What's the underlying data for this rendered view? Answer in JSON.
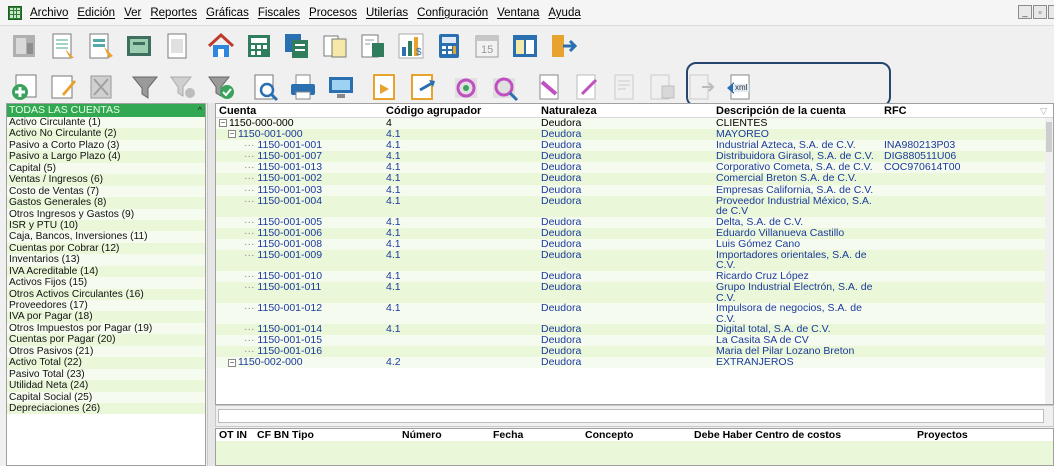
{
  "menu": [
    {
      "label": "Archivo"
    },
    {
      "label": "Edición"
    },
    {
      "label": "Ver"
    },
    {
      "label": "Reportes"
    },
    {
      "label": "Gráficas"
    },
    {
      "label": "Fiscales"
    },
    {
      "label": "Procesos"
    },
    {
      "label": "Utilerías"
    },
    {
      "label": "Configuración"
    },
    {
      "label": "Ventana"
    },
    {
      "label": "Ayuda"
    }
  ],
  "window_controls": {
    "minimize": "_",
    "restore": "▫"
  },
  "toolbar1_icons": [
    "company-icon",
    "catalog-icon",
    "accounts-icon",
    "policies-icon",
    "balance-icon",
    "home-icon",
    "calculator-doc-icon",
    "copy-icon",
    "documents-icon",
    "report-icon",
    "chart-icon",
    "calculator-icon",
    "calendar-icon",
    "window-icon",
    "exit-icon"
  ],
  "toolbar2_icons": [
    "add-account-icon",
    "edit-account-icon",
    "delete-account-icon",
    "filter-icon",
    "filter-clear-icon",
    "filter-apply-icon",
    "search-icon",
    "print-icon",
    "screen-preview-icon",
    "folder-icon",
    "export-icon",
    "ring-icon",
    "ring-search-icon",
    "document-link-icon",
    "document-edit-icon",
    "document-stamp-icon",
    "document-send-icon",
    "document-export-icon",
    "xml-icon"
  ],
  "xml_label": "xml",
  "sidebar": {
    "header": "TODAS LAS CUENTAS",
    "items": [
      "Activo Circulante (1)",
      "Activo No Circulante (2)",
      "Pasivo a Corto Plazo (3)",
      "Pasivo a Largo Plazo (4)",
      "Capital (5)",
      "Ventas / Ingresos (6)",
      "Costo de Ventas (7)",
      "Gastos Generales (8)",
      "Otros Ingresos y Gastos (9)",
      "ISR y PTU (10)",
      "Caja, Bancos, Inversiones (11)",
      "Cuentas por Cobrar (12)",
      "Inventarios (13)",
      "IVA Acreditable (14)",
      "Activos Fijos (15)",
      "Otros Activos Circulantes (16)",
      "Proveedores (17)",
      "IVA por Pagar (18)",
      "Otros Impuestos por Pagar (19)",
      "Cuentas por Pagar (20)",
      "Otros Pasivos (21)",
      "Activo Total (22)",
      "Pasivo Total (23)",
      "Utilidad Neta (24)",
      "Capital Social (25)",
      "Depreciaciones (26)"
    ]
  },
  "grid": {
    "columns": [
      "Cuenta",
      "Código agrupador",
      "Naturaleza",
      "Descripción de la cuenta",
      "RFC"
    ],
    "rows": [
      {
        "cuenta": "1150-000-000",
        "codigo": "4",
        "naturaleza": "Deudora",
        "descripcion": "CLIENTES",
        "rfc": "",
        "level": 0
      },
      {
        "cuenta": "1150-001-000",
        "codigo": "4.1",
        "naturaleza": "Deudora",
        "descripcion": "MAYOREO",
        "rfc": "",
        "level": 1
      },
      {
        "cuenta": "1150-001-001",
        "codigo": "4.1",
        "naturaleza": "Deudora",
        "descripcion": "Industrial Azteca, S.A. de C.V.",
        "rfc": "INA980213P03",
        "level": 2
      },
      {
        "cuenta": "1150-001-007",
        "codigo": "4.1",
        "naturaleza": "Deudora",
        "descripcion": "Distribuidora Girasol, S.A. de C.V.",
        "rfc": "DIG880511U06",
        "level": 2
      },
      {
        "cuenta": "1150-001-013",
        "codigo": "4.1",
        "naturaleza": "Deudora",
        "descripcion": "Corporativo Cometa, S.A. de C.V.",
        "rfc": "COC970614T00",
        "level": 2
      },
      {
        "cuenta": "1150-001-002",
        "codigo": "4.1",
        "naturaleza": "Deudora",
        "descripcion": "Comercial Breton S.A. de C.V.",
        "rfc": "",
        "level": 2
      },
      {
        "cuenta": "1150-001-003",
        "codigo": "4.1",
        "naturaleza": "Deudora",
        "descripcion": "Empresas California, S.A. de C.V.",
        "rfc": "",
        "level": 2
      },
      {
        "cuenta": "1150-001-004",
        "codigo": "4.1",
        "naturaleza": "Deudora",
        "descripcion": "Proveedor Industrial México, S.A. de C.V",
        "rfc": "",
        "level": 2,
        "tall": true
      },
      {
        "cuenta": "1150-001-005",
        "codigo": "4.1",
        "naturaleza": "Deudora",
        "descripcion": "Delta, S.A. de C.V.",
        "rfc": "",
        "level": 2
      },
      {
        "cuenta": "1150-001-006",
        "codigo": "4.1",
        "naturaleza": "Deudora",
        "descripcion": "Eduardo Villanueva Castillo",
        "rfc": "",
        "level": 2
      },
      {
        "cuenta": "1150-001-008",
        "codigo": "4.1",
        "naturaleza": "Deudora",
        "descripcion": "Luis Gómez Cano",
        "rfc": "",
        "level": 2
      },
      {
        "cuenta": "1150-001-009",
        "codigo": "4.1",
        "naturaleza": "Deudora",
        "descripcion": "Importadores orientales, S.A. de C.V.",
        "rfc": "",
        "level": 2,
        "tall": true
      },
      {
        "cuenta": "1150-001-010",
        "codigo": "4.1",
        "naturaleza": "Deudora",
        "descripcion": "Ricardo Cruz López",
        "rfc": "",
        "level": 2
      },
      {
        "cuenta": "1150-001-011",
        "codigo": "4.1",
        "naturaleza": "Deudora",
        "descripcion": "Grupo Industrial Electrón, S.A. de C.V.",
        "rfc": "",
        "level": 2,
        "tall": true
      },
      {
        "cuenta": "1150-001-012",
        "codigo": "4.1",
        "naturaleza": "Deudora",
        "descripcion": "Impulsora de negocios, S.A. de C.V.",
        "rfc": "",
        "level": 2,
        "tall": true
      },
      {
        "cuenta": "1150-001-014",
        "codigo": "4.1",
        "naturaleza": "Deudora",
        "descripcion": "Digital total, S.A. de C.V.",
        "rfc": "",
        "level": 2
      },
      {
        "cuenta": "1150-001-015",
        "codigo": "",
        "naturaleza": "Deudora",
        "descripcion": "La Casita SA de CV",
        "rfc": "",
        "level": 2
      },
      {
        "cuenta": "1150-001-016",
        "codigo": "",
        "naturaleza": "Deudora",
        "descripcion": "Maria del Pilar Lozano Breton",
        "rfc": "",
        "level": 2
      },
      {
        "cuenta": "1150-002-000",
        "codigo": "4.2",
        "naturaleza": "Deudora",
        "descripcion": "EXTRANJEROS",
        "rfc": "",
        "level": 1
      }
    ]
  },
  "detail": {
    "columns": [
      "OT IN",
      "CF BN Tipo",
      "Número",
      "Fecha",
      "Concepto",
      "Debe Haber Centro de costos",
      "Proyectos"
    ]
  }
}
